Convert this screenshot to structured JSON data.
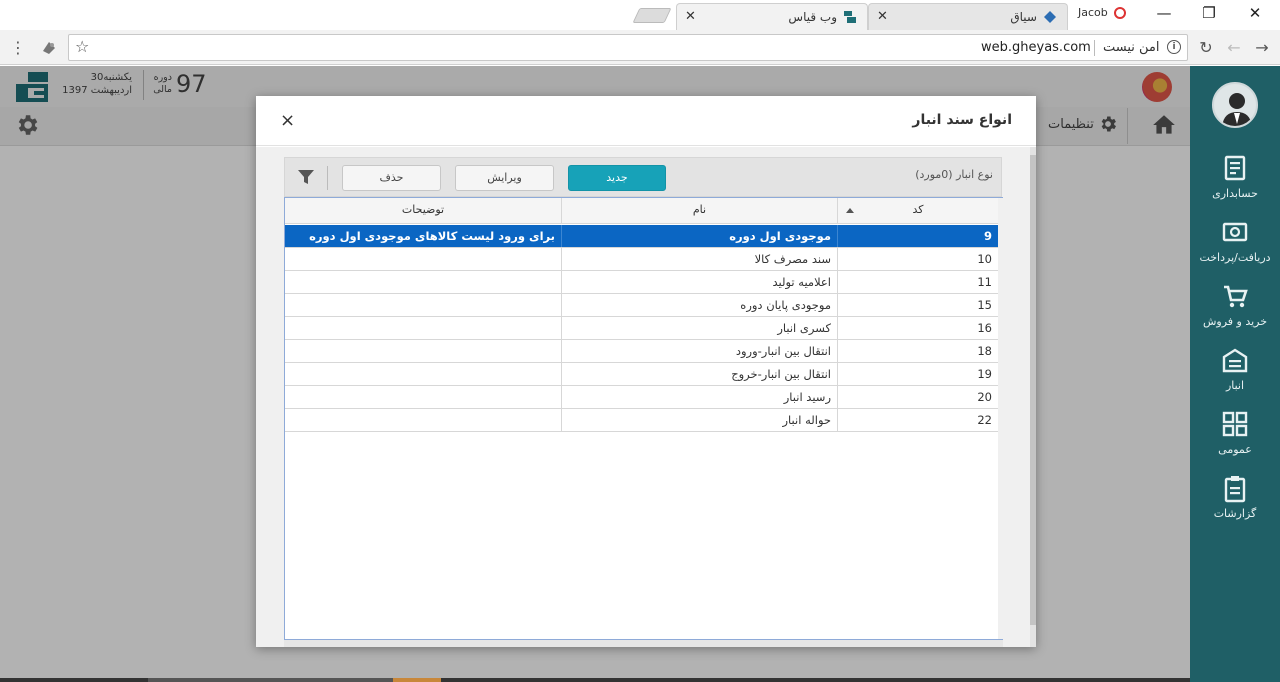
{
  "browser": {
    "tabs": [
      {
        "title": "سیاق"
      },
      {
        "title": "وب قیاس"
      }
    ],
    "profile_name": "Jacob",
    "url": "web.gheyas.com",
    "security_label": "امن نیست"
  },
  "header": {
    "date_day": "یکشنبه30",
    "date_month_year": "اردیبهشت 1397",
    "period_label_1": "دوره",
    "period_label_2": "مالی",
    "period_number": "97"
  },
  "nav": {
    "settings_label": "تنظیمات"
  },
  "sidebar": {
    "items": [
      {
        "label": "حسابداری",
        "icon": "accounting-icon"
      },
      {
        "label": "دریافت/پرداخت",
        "icon": "receive-pay-icon"
      },
      {
        "label": "خرید و فروش",
        "icon": "cart-icon"
      },
      {
        "label": "انبار",
        "icon": "warehouse-icon"
      },
      {
        "label": "عمومی",
        "icon": "general-icon"
      },
      {
        "label": "گزارشات",
        "icon": "reports-icon"
      }
    ]
  },
  "modal": {
    "title": "انواع سند انبار",
    "close": "×",
    "grid_caption": "نوع انبار (0مورد)",
    "buttons": {
      "new": "جدید",
      "edit": "ویرایش",
      "delete": "حذف"
    },
    "columns": {
      "code": "کد",
      "name": "نام",
      "description": "توضیحات"
    },
    "rows": [
      {
        "code": "9",
        "name": "موجودی اول دوره",
        "description": "برای ورود لیست کالاهای موجودی اول دوره",
        "selected": true
      },
      {
        "code": "10",
        "name": "سند مصرف کالا",
        "description": ""
      },
      {
        "code": "11",
        "name": "اعلامیه تولید",
        "description": ""
      },
      {
        "code": "15",
        "name": "موجودی پایان دوره",
        "description": ""
      },
      {
        "code": "16",
        "name": "کسری انبار",
        "description": ""
      },
      {
        "code": "18",
        "name": "انتقال بین انبار-ورود",
        "description": ""
      },
      {
        "code": "19",
        "name": "انتقال بین انبار-خروج",
        "description": ""
      },
      {
        "code": "20",
        "name": "رسید انبار",
        "description": ""
      },
      {
        "code": "22",
        "name": "حواله انبار",
        "description": ""
      }
    ]
  },
  "colors": {
    "sidebar": "#1f5f66",
    "primary_button": "#17a2b8",
    "selected_row": "#0b66c3"
  }
}
